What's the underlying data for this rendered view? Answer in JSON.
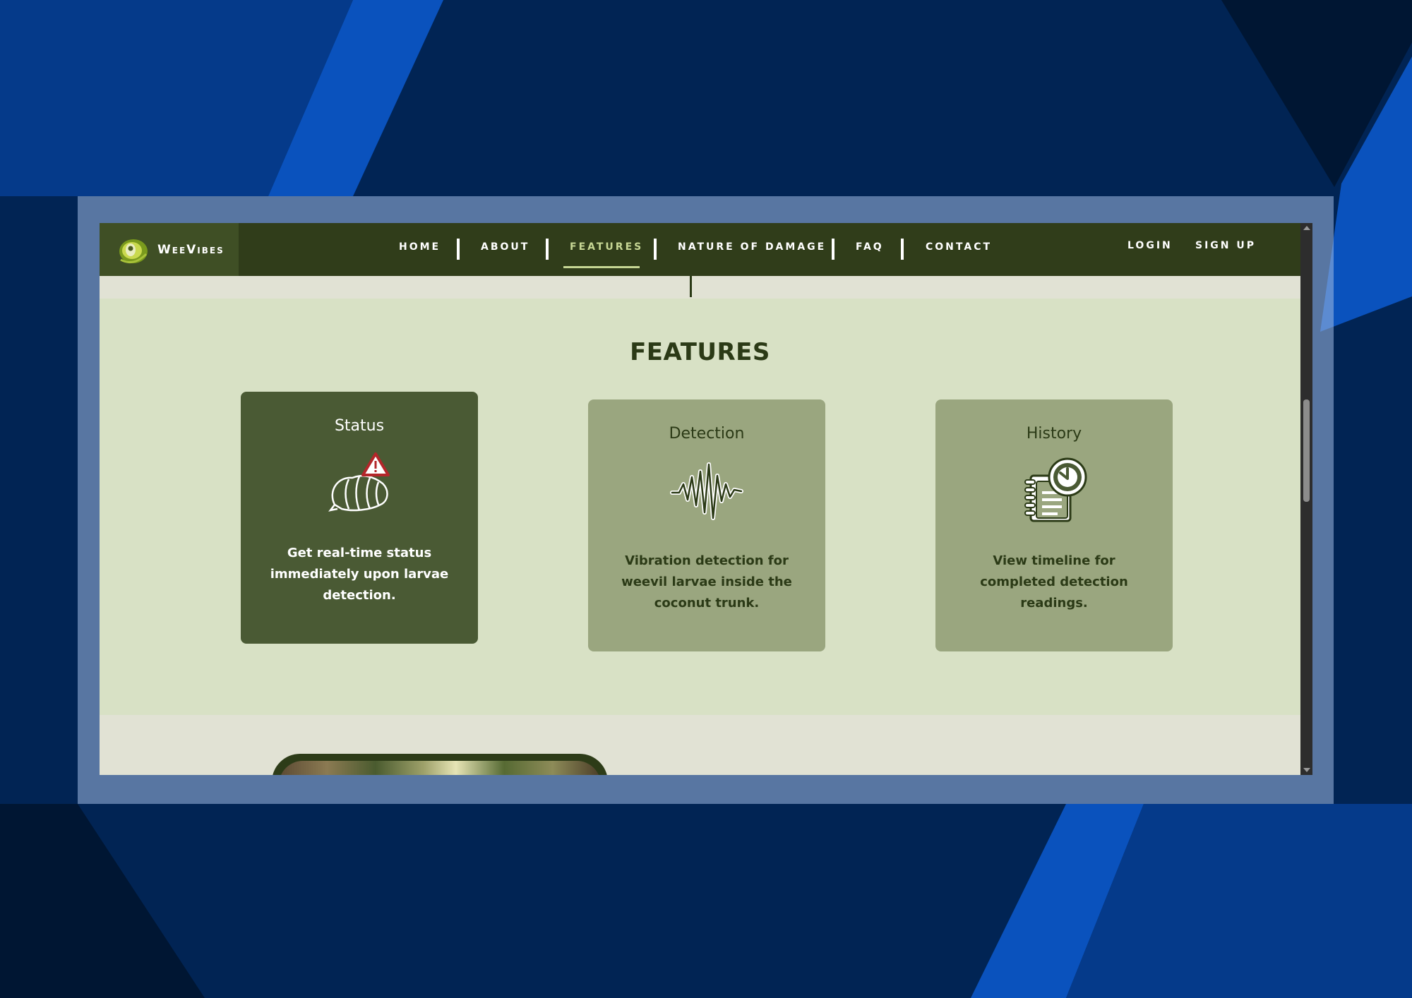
{
  "brand": {
    "name": "WeeVibes"
  },
  "nav": {
    "items": [
      {
        "label": "HOME"
      },
      {
        "label": "ABOUT"
      },
      {
        "label": "FEATURES",
        "active": true
      },
      {
        "label": "NATURE OF DAMAGE"
      },
      {
        "label": "FAQ"
      },
      {
        "label": "CONTACT"
      }
    ],
    "login": "LOGIN",
    "signup": "SIGN UP"
  },
  "features": {
    "title": "FEATURES",
    "cards": [
      {
        "title": "Status",
        "icon": "larvae-warning-icon",
        "description": "Get real-time status immediately upon larvae detection.",
        "active": true
      },
      {
        "title": "Detection",
        "icon": "vibration-wave-icon",
        "description": "Vibration detection for weevil larvae inside the coconut trunk."
      },
      {
        "title": "History",
        "icon": "history-clock-notebook-icon",
        "description": "View timeline for completed detection readings."
      }
    ]
  },
  "colors": {
    "nav_bg": "#303d1a",
    "active_nav": "#c6d694",
    "section_bg": "#d8e1c5",
    "card_active": "#4a5a34",
    "card_default": "#9aa67f",
    "desktop_bg": "#00214f"
  }
}
